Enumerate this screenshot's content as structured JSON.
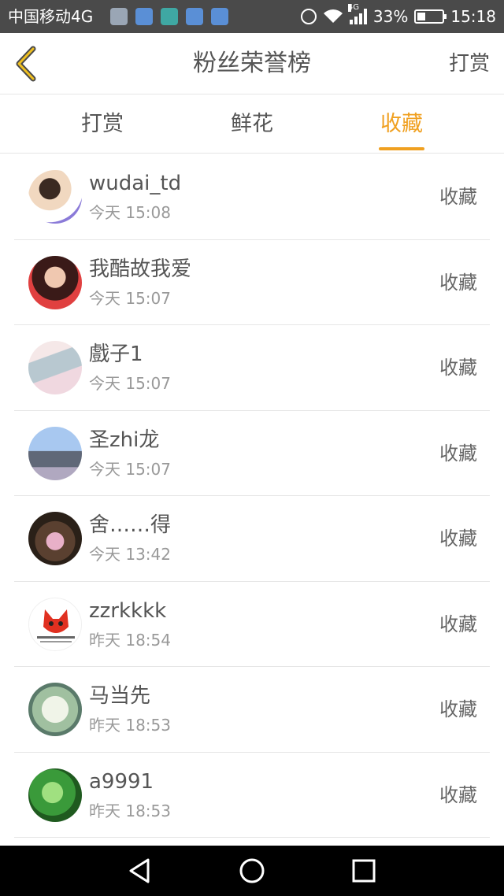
{
  "status_bar": {
    "carrier": "中国移动4G",
    "network": "4G",
    "battery": "33%",
    "battery_level": 0.33,
    "time": "15:18"
  },
  "header": {
    "title": "粉丝荣誉榜",
    "right_label": "打赏",
    "back_icon": "chevron-left-icon"
  },
  "tabs": [
    {
      "label": "打赏",
      "active": false
    },
    {
      "label": "鲜花",
      "active": false
    },
    {
      "label": "收藏",
      "active": true
    }
  ],
  "colors": {
    "accent": "#f0a020",
    "text": "#555555",
    "subtext": "#999999",
    "divider": "#e6e6e6",
    "status_bar": "#4a4a4a"
  },
  "list": [
    {
      "name": "wudai_td",
      "time": "今天 15:08",
      "action": "收藏"
    },
    {
      "name": "我酷故我爱",
      "time": "今天 15:07",
      "action": "收藏"
    },
    {
      "name": "戲子1",
      "time": "今天 15:07",
      "action": "收藏"
    },
    {
      "name": "圣zhi龙",
      "time": "今天 15:07",
      "action": "收藏"
    },
    {
      "name": "舍……得",
      "time": "今天 13:42",
      "action": "收藏"
    },
    {
      "name": "zzrkkkk",
      "time": "昨天 18:54",
      "action": "收藏"
    },
    {
      "name": "马当先",
      "time": "昨天 18:53",
      "action": "收藏"
    },
    {
      "name": "a9991",
      "time": "昨天 18:53",
      "action": "收藏"
    }
  ],
  "nav_bar": {
    "icons": [
      "back-triangle-icon",
      "home-circle-icon",
      "recent-square-icon"
    ]
  }
}
